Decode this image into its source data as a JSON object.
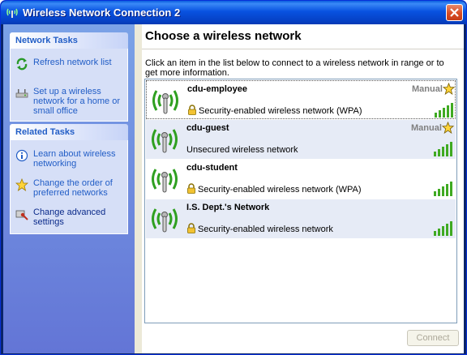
{
  "window": {
    "title": "Wireless Network Connection 2",
    "title_icon": "wireless-icon",
    "close_icon": "close-icon"
  },
  "task_pane": {
    "network_tasks": {
      "title": "Network Tasks",
      "items": [
        {
          "label": "Refresh network list",
          "icon": "refresh-icon"
        },
        {
          "label": "Set up a wireless network for a home or small office",
          "icon": "setup-network-icon"
        }
      ]
    },
    "related_tasks": {
      "title": "Related Tasks",
      "items": [
        {
          "label": "Learn about wireless networking",
          "icon": "info-icon"
        },
        {
          "label": "Change the order of preferred networks",
          "icon": "star-icon"
        },
        {
          "label": "Change advanced settings",
          "icon": "settings-icon"
        }
      ]
    }
  },
  "main": {
    "heading": "Choose a wireless network",
    "instructions": "Click an item in the list below to connect to a wireless network in range or to get more information.",
    "networks": [
      {
        "ssid": "cdu-employee",
        "security": "Security-enabled wireless network (WPA)",
        "secured": true,
        "tag": "Manual",
        "preferred": true,
        "signal_bars": 5,
        "selected": true
      },
      {
        "ssid": "cdu-guest",
        "security": "Unsecured wireless network",
        "secured": false,
        "tag": "Manual",
        "preferred": true,
        "signal_bars": 5,
        "selected": false
      },
      {
        "ssid": "cdu-student",
        "security": "Security-enabled wireless network (WPA)",
        "secured": true,
        "tag": "",
        "preferred": false,
        "signal_bars": 5,
        "selected": false
      },
      {
        "ssid": "I.S. Dept.'s Network",
        "security": "Security-enabled wireless network",
        "secured": true,
        "tag": "",
        "preferred": false,
        "signal_bars": 5,
        "selected": false
      }
    ],
    "connect_label": "Connect"
  },
  "colors": {
    "titlebar": "#0852e0",
    "task_link": "#215dc6",
    "signal_green": "#3faa22",
    "row_alt": "#e6ebf6"
  }
}
